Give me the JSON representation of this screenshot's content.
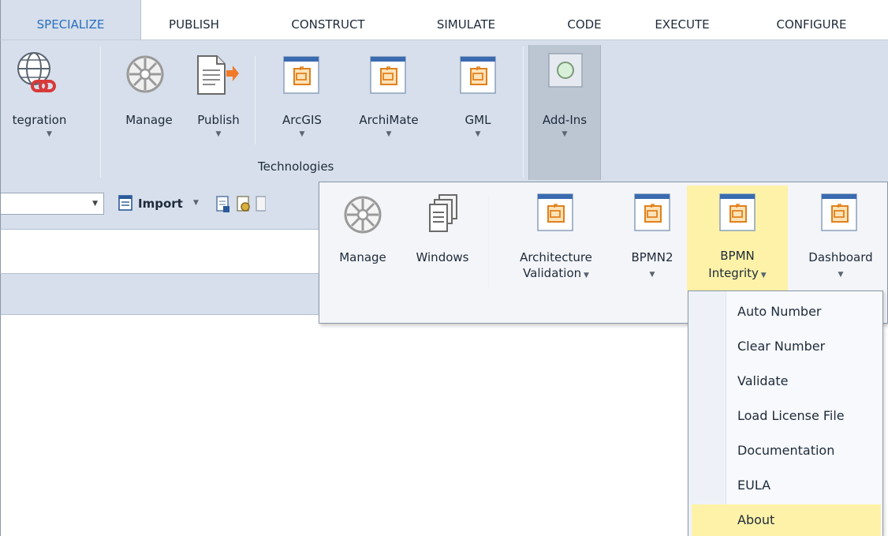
{
  "tabs": [
    "SPECIALIZE",
    "PUBLISH",
    "CONSTRUCT",
    "SIMULATE",
    "CODE",
    "EXECUTE",
    "CONFIGURE"
  ],
  "ribbon": {
    "integration_label": "tegration",
    "manage_label": "Manage",
    "publish_label": "Publish",
    "arcgis_label": "ArcGIS",
    "archimate_label": "ArchiMate",
    "gml_label": "GML",
    "addins_label": "Add-Ins",
    "technologies_group_label": "Technologies"
  },
  "toolbar": {
    "import_label": "Import"
  },
  "addins_panel": {
    "manage_label": "Manage",
    "windows_label": "Windows",
    "architecture_validation_label_1": "Architecture",
    "architecture_validation_label_2": "Validation",
    "bpmn2_label": "BPMN2",
    "bpmn_integrity_label_1": "BPMN",
    "bpmn_integrity_label_2": "Integrity",
    "dashboard_label": "Dashboard"
  },
  "bpmn_menu": {
    "items": [
      "Auto Number",
      "Clear Number",
      "Validate",
      "Load License File",
      "Documentation",
      "EULA",
      "About"
    ],
    "highlighted": "About"
  },
  "colors": {
    "ribbon_bg": "#d6dfeb",
    "active_tab_text": "#2a6fc0",
    "highlight": "#fdf2a8"
  }
}
